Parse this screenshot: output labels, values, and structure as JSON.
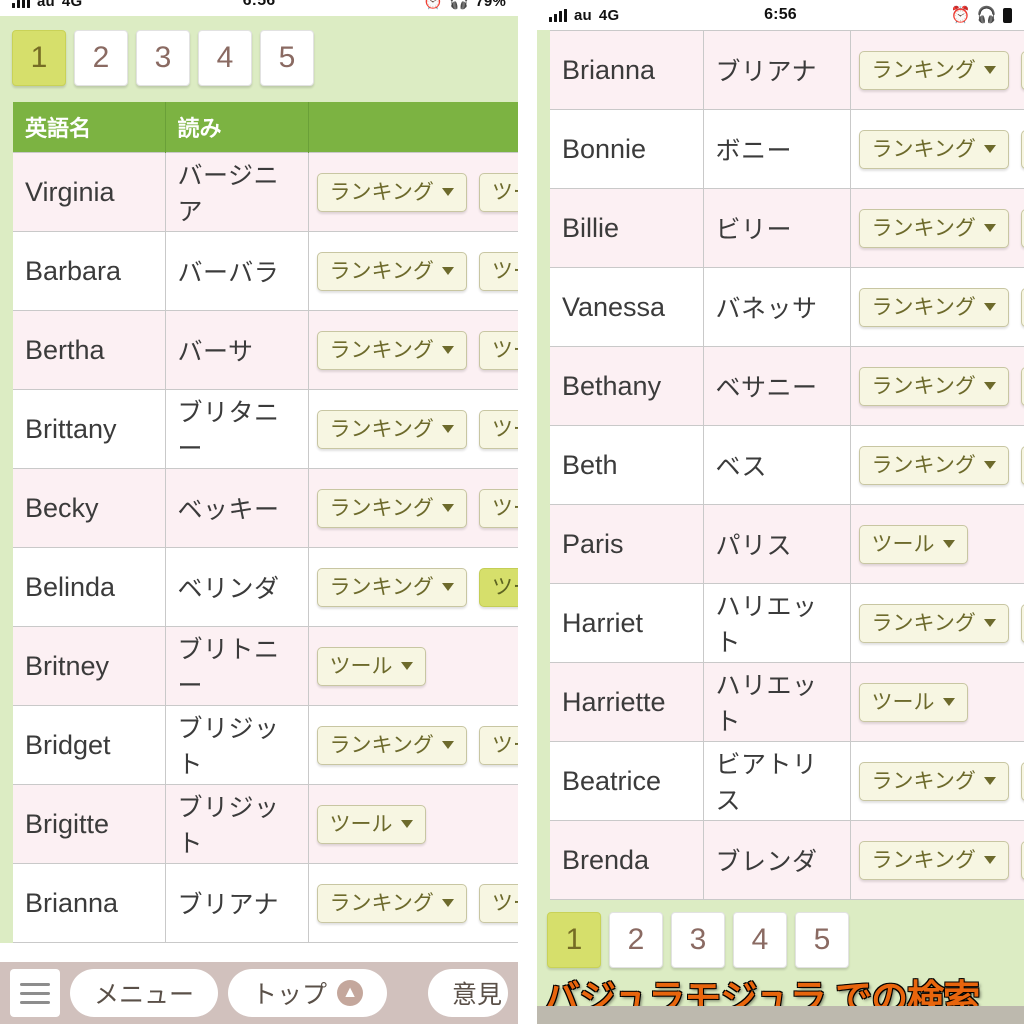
{
  "left_panel": {
    "status_bar": {
      "signal_icon": "signal-bars-icon",
      "carrier": "au",
      "network": "4G",
      "time": "6:56",
      "alarm_icon": "alarm-clock-icon",
      "headphone_icon": "headphones-icon",
      "battery_pct": "79%"
    },
    "pagination": {
      "pages": [
        "1",
        "2",
        "3",
        "4",
        "5"
      ],
      "active": "1"
    },
    "table": {
      "headers": [
        "英語名",
        "読み",
        ""
      ],
      "rows": [
        {
          "english": "Virginia",
          "kana": "バージニア",
          "buttons": [
            "ランキング",
            "ツール"
          ],
          "highlight": ""
        },
        {
          "english": "Barbara",
          "kana": "バーバラ",
          "buttons": [
            "ランキング",
            "ツール"
          ],
          "highlight": ""
        },
        {
          "english": "Bertha",
          "kana": "バーサ",
          "buttons": [
            "ランキング",
            "ツール"
          ],
          "highlight": ""
        },
        {
          "english": "Brittany",
          "kana": "ブリタニー",
          "buttons": [
            "ランキング",
            "ツール"
          ],
          "highlight": ""
        },
        {
          "english": "Becky",
          "kana": "ベッキー",
          "buttons": [
            "ランキング",
            "ツール"
          ],
          "highlight": ""
        },
        {
          "english": "Belinda",
          "kana": "ベリンダ",
          "buttons": [
            "ランキング",
            "ツール"
          ],
          "highlight": "ツール"
        },
        {
          "english": "Britney",
          "kana": "ブリトニー",
          "buttons": [
            "ツール"
          ],
          "highlight": ""
        },
        {
          "english": "Bridget",
          "kana": "ブリジット",
          "buttons": [
            "ランキング",
            "ツール"
          ],
          "highlight": ""
        },
        {
          "english": "Brigitte",
          "kana": "ブリジット",
          "buttons": [
            "ツール"
          ],
          "highlight": ""
        },
        {
          "english": "Brianna",
          "kana": "ブリアナ",
          "buttons": [
            "ランキング",
            "ツール"
          ],
          "highlight": ""
        }
      ]
    },
    "bottom_bar": {
      "menu_icon": "hamburger-menu-icon",
      "menu_label": "メニュー",
      "top_label": "トップ",
      "top_icon": "arrow-up-circle-icon",
      "feedback_label": "意見"
    }
  },
  "right_panel": {
    "status_bar": {
      "signal_icon": "signal-bars-icon",
      "carrier": "au",
      "network": "4G",
      "time": "6:56",
      "alarm_icon": "alarm-clock-icon",
      "headphone_icon": "headphones-icon",
      "battery_icon": "battery-icon"
    },
    "table": {
      "rows": [
        {
          "english": "Brianna",
          "kana": "ブリアナ",
          "buttons": [
            "ランキング",
            "ツ"
          ],
          "highlight": ""
        },
        {
          "english": "Bonnie",
          "kana": "ボニー",
          "buttons": [
            "ランキング",
            "ツ"
          ],
          "highlight": ""
        },
        {
          "english": "Billie",
          "kana": "ビリー",
          "buttons": [
            "ランキング",
            "ツ"
          ],
          "highlight": ""
        },
        {
          "english": "Vanessa",
          "kana": "バネッサ",
          "buttons": [
            "ランキング",
            "ツ"
          ],
          "highlight": ""
        },
        {
          "english": "Bethany",
          "kana": "ベサニー",
          "buttons": [
            "ランキング",
            "ツ"
          ],
          "highlight": ""
        },
        {
          "english": "Beth",
          "kana": "ベス",
          "buttons": [
            "ランキング",
            "ツ"
          ],
          "highlight": ""
        },
        {
          "english": "Paris",
          "kana": "パリス",
          "buttons": [
            "ツール"
          ],
          "highlight": ""
        },
        {
          "english": "Harriet",
          "kana": "ハリエット",
          "buttons": [
            "ランキング",
            "ツ"
          ],
          "highlight": ""
        },
        {
          "english": "Harriette",
          "kana": "ハリエット",
          "buttons": [
            "ツール"
          ],
          "highlight": ""
        },
        {
          "english": "Beatrice",
          "kana": "ビアトリス",
          "buttons": [
            "ランキング",
            "ツ"
          ],
          "highlight": ""
        },
        {
          "english": "Brenda",
          "kana": "ブレンダ",
          "buttons": [
            "ランキング",
            "ツ"
          ],
          "highlight": ""
        }
      ]
    },
    "pagination": {
      "pages": [
        "1",
        "2",
        "3",
        "4",
        "5"
      ],
      "active": "1"
    },
    "search_caption": "バジュラモジュラ での検索"
  },
  "colors": {
    "header_green": "#7cb342",
    "page_bg_green": "#dcecc3",
    "active_page": "#d6df6b",
    "row_pink": "#fcf0f3",
    "button_cream": "#f7f6e2",
    "search_orange": "#e8650d"
  }
}
